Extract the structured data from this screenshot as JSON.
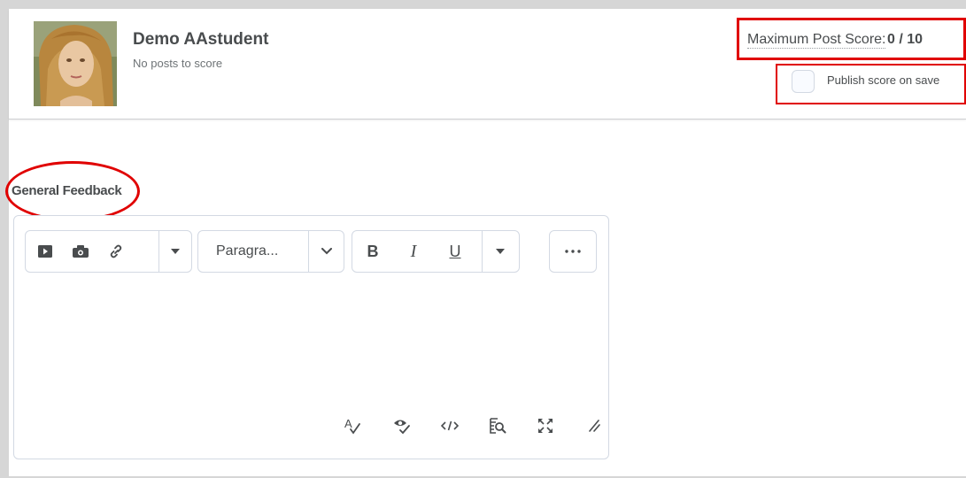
{
  "student": {
    "name": "Demo AAstudent",
    "status": "No posts to score"
  },
  "score": {
    "label": "Maximum Post Score:",
    "value": "0 / 10"
  },
  "publish": {
    "label": "Publish score on save",
    "checked": false
  },
  "feedback": {
    "label": "General Feedback"
  },
  "editor": {
    "toolbar": {
      "insert_group": [
        "video-icon",
        "camera-icon",
        "link-icon",
        "caret-down-icon"
      ],
      "paragraph_format": "Paragra...",
      "format_group": [
        "bold-icon",
        "italic-icon",
        "underline-icon",
        "caret-down-icon"
      ],
      "more_icon": "ellipsis-icon",
      "bold": "B",
      "italic": "I",
      "underline": "U"
    },
    "footer_icons": [
      "spellcheck-icon",
      "accessibility-check-icon",
      "source-code-icon",
      "preview-icon",
      "fullscreen-icon",
      "resize-icon"
    ],
    "content": ""
  },
  "colors": {
    "annotation": "#e00000",
    "text": "#494c4e",
    "border": "#d3d9e3"
  }
}
